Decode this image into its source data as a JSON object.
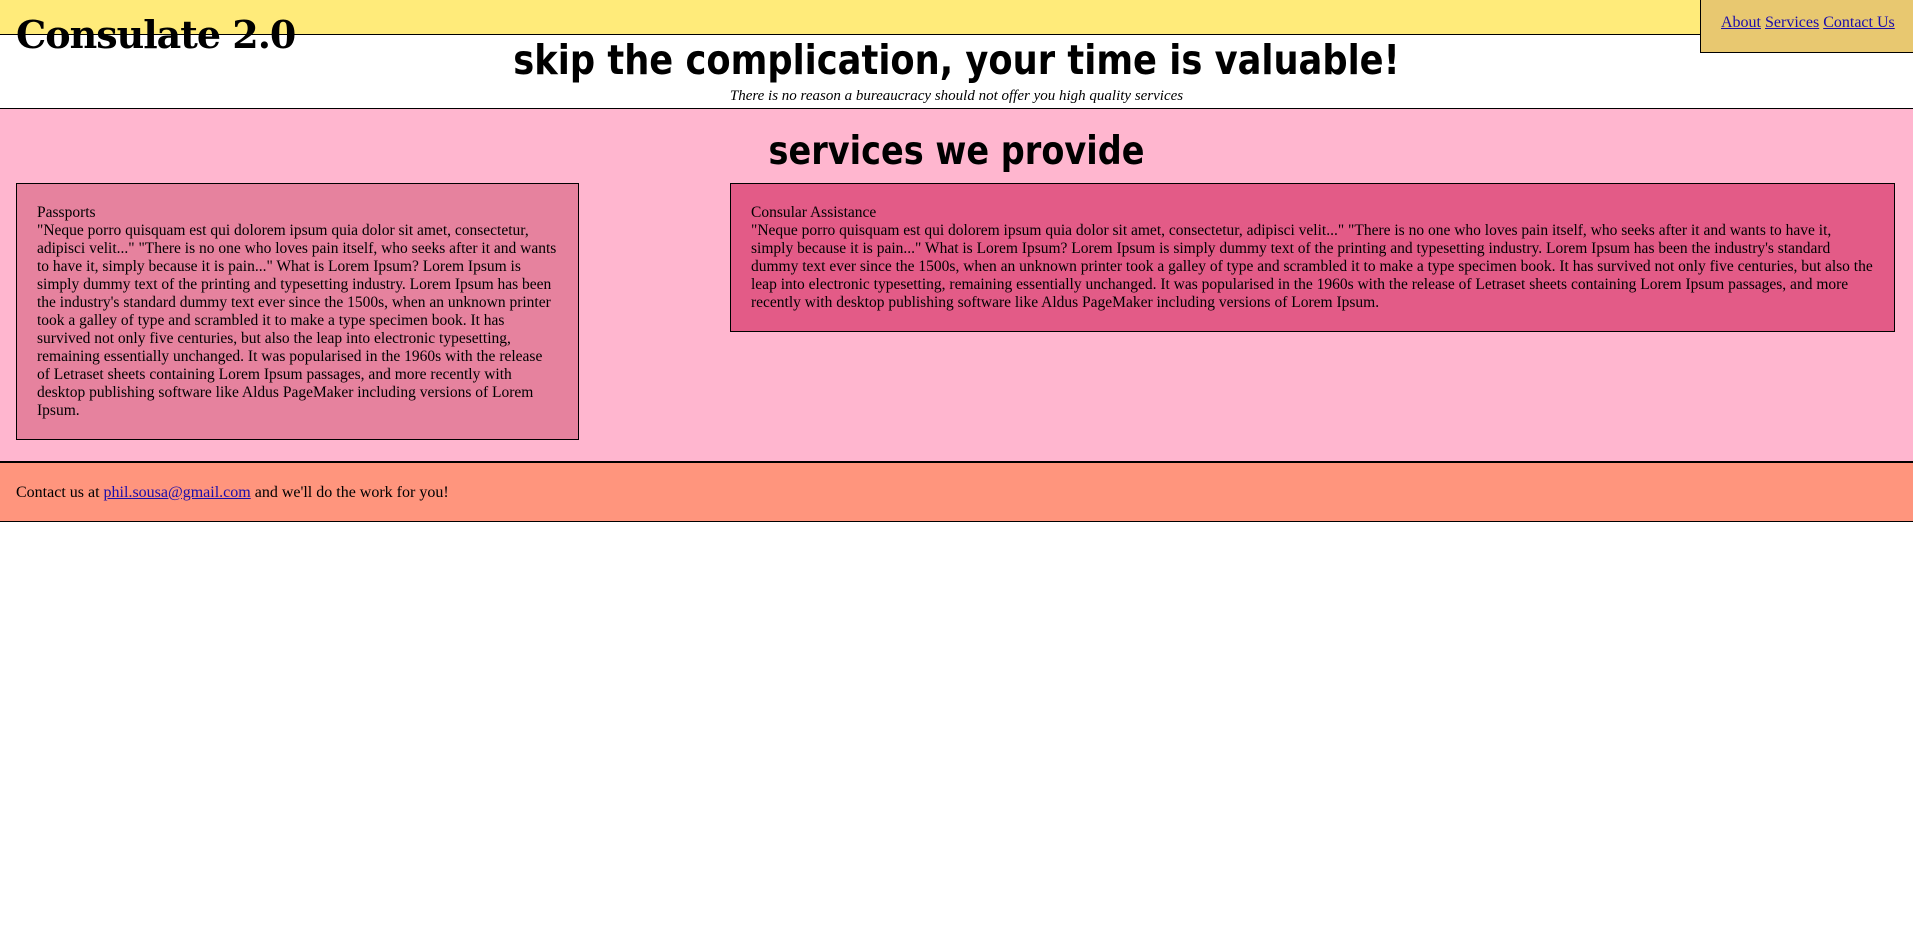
{
  "header": {
    "brand": "Consulate 2.0",
    "nav": {
      "about": "About",
      "services": "Services",
      "contact": "Contact Us"
    }
  },
  "hero": {
    "title": "skip the complication, your time is valuable!",
    "subtitle": "There is no reason a bureaucracy should not offer you high quality services"
  },
  "services": {
    "heading": "services we provide",
    "cards": [
      {
        "title": "Passports",
        "body": "\"Neque porro quisquam est qui dolorem ipsum quia dolor sit amet, consectetur, adipisci velit...\" \"There is no one who loves pain itself, who seeks after it and wants to have it, simply because it is pain...\" What is Lorem Ipsum? Lorem Ipsum is simply dummy text of the printing and typesetting industry. Lorem Ipsum has been the industry's standard dummy text ever since the 1500s, when an unknown printer took a galley of type and scrambled it to make a type specimen book. It has survived not only five centuries, but also the leap into electronic typesetting, remaining essentially unchanged. It was popularised in the 1960s with the release of Letraset sheets containing Lorem Ipsum passages, and more recently with desktop publishing software like Aldus PageMaker including versions of Lorem Ipsum."
      },
      {
        "title": "Consular Assistance",
        "body": "\"Neque porro quisquam est qui dolorem ipsum quia dolor sit amet, consectetur, adipisci velit...\" \"There is no one who loves pain itself, who seeks after it and wants to have it, simply because it is pain...\" What is Lorem Ipsum? Lorem Ipsum is simply dummy text of the printing and typesetting industry. Lorem Ipsum has been the industry's standard dummy text ever since the 1500s, when an unknown printer took a galley of type and scrambled it to make a type specimen book. It has survived not only five centuries, but also the leap into electronic typesetting, remaining essentially unchanged. It was popularised in the 1960s with the release of Letraset sheets containing Lorem Ipsum passages, and more recently with desktop publishing software like Aldus PageMaker including versions of Lorem Ipsum."
      }
    ]
  },
  "footer": {
    "prefix": "Contact us at",
    "email": "phil.sousa@gmail.com",
    "suffix": "and we'll do the work for you!"
  },
  "colors": {
    "topbar": "#ffeb7a",
    "nav_box": "#e8c870",
    "services_bg": "#ffb6cf",
    "card_passports": "#e6829e",
    "card_consular": "#e35b87",
    "footer": "#ff957d",
    "link": "#1a0dab"
  }
}
